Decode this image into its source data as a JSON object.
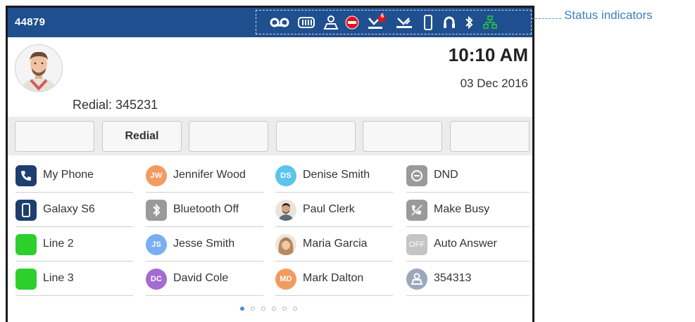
{
  "topbar": {
    "extension": "44879",
    "status_icons": [
      "voicemail-icon",
      "battery-icon",
      "presence-icon",
      "dnd-icon",
      "missed-calls-icon",
      "call-forward-icon",
      "mobile-device-icon",
      "headset-icon",
      "bluetooth-icon",
      "network-icon"
    ],
    "missed_count": "6"
  },
  "callout": {
    "label": "Status indicators"
  },
  "clock": {
    "time": "10:10 AM",
    "date": "03 Dec 2016"
  },
  "redial": {
    "text": "Redial: 345231"
  },
  "softkeys": [
    "",
    "Redial",
    "",
    "",
    "",
    ""
  ],
  "programmable_keys": [
    [
      {
        "label": "My Phone",
        "icon": "phone-icon"
      },
      {
        "label": "Galaxy S6",
        "icon": "mobile-phone-icon"
      },
      {
        "label": "Line 2",
        "icon": "line-status-icon"
      },
      {
        "label": "Line 3",
        "icon": "line-status-icon"
      }
    ],
    [
      {
        "label": "Jennifer Wood",
        "initials": "JW"
      },
      {
        "label": "Bluetooth Off",
        "icon": "bluetooth-icon"
      },
      {
        "label": "Jesse Smith",
        "initials": "JS"
      },
      {
        "label": "David Cole",
        "initials": "DC"
      }
    ],
    [
      {
        "label": "Denise Smith",
        "initials": "DS"
      },
      {
        "label": "Paul Clerk",
        "icon": "contact-photo"
      },
      {
        "label": "Maria Garcia",
        "icon": "contact-photo"
      },
      {
        "label": "Mark Dalton",
        "initials": "MD"
      }
    ],
    [
      {
        "label": "DND",
        "icon": "dnd-icon"
      },
      {
        "label": "Make Busy",
        "icon": "make-busy-icon"
      },
      {
        "label": "Auto Answer",
        "badge": "OFF"
      },
      {
        "label": "354313",
        "icon": "user-icon"
      }
    ]
  ],
  "colors": {
    "topbar": "#1f4f8f",
    "status_green": "#22b14c",
    "status_red": "#e0141e",
    "avatar_orange": "#f29b61",
    "avatar_blue": "#5bc4ea",
    "avatar_lightblue": "#7aaef0",
    "avatar_purple": "#a46bd1",
    "key_gray": "#9a9a9a",
    "line_green": "#2ccf2c",
    "phone_navy": "#1d3e6e"
  },
  "pagination": {
    "pages": 6,
    "current": 1
  }
}
